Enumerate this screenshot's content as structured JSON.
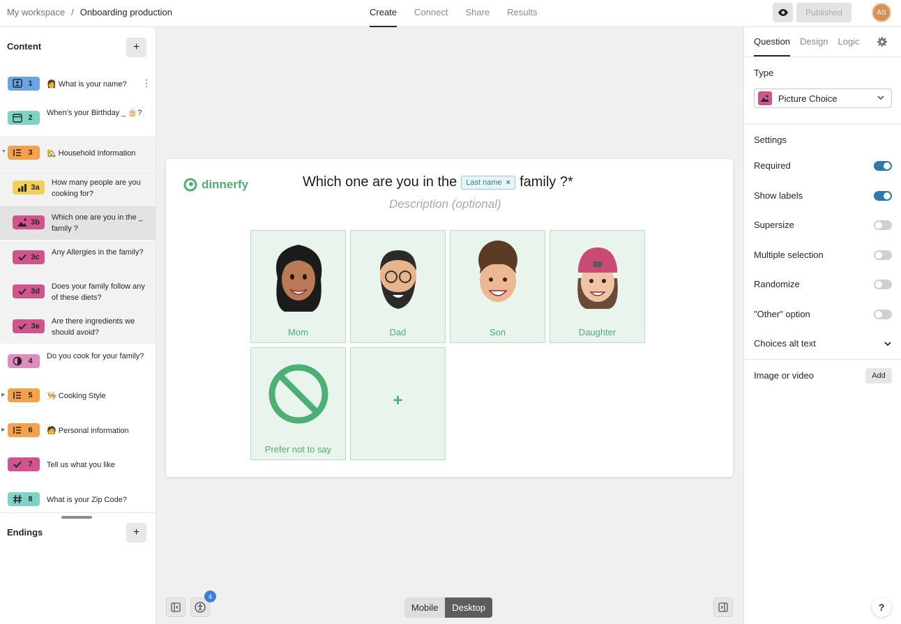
{
  "breadcrumb": {
    "workspace": "My workspace",
    "separator": "/",
    "form": "Onboarding production"
  },
  "nav": {
    "tabs": [
      "Create",
      "Connect",
      "Share",
      "Results"
    ],
    "active": "Create"
  },
  "header": {
    "published_label": "Published",
    "avatar_initials": "AS"
  },
  "sidebar": {
    "content_title": "Content",
    "endings_title": "Endings",
    "items": [
      {
        "num": "1",
        "color": "#6aa3e8",
        "icon": "contact-icon",
        "text": "👩 What is your name?"
      },
      {
        "num": "2",
        "color": "#7fd3c6",
        "icon": "calendar-icon",
        "text": "When's your Birthday _ 🎂?"
      },
      {
        "num": "3",
        "color": "#f4a14a",
        "icon": "list-icon",
        "text": "🏡 Household Information"
      },
      {
        "num": "3a",
        "color": "#f2cf58",
        "icon": "bar-chart-icon",
        "text": "How many people are you cooking for?"
      },
      {
        "num": "3b",
        "color": "#d0558f",
        "icon": "picture-icon",
        "text": "Which one are you in the _ family ?"
      },
      {
        "num": "3c",
        "color": "#d0558f",
        "icon": "check-icon",
        "text": "Any Allergies in the family?"
      },
      {
        "num": "3d",
        "color": "#d0558f",
        "icon": "check-icon",
        "text": "Does your family follow any of these diets?"
      },
      {
        "num": "3e",
        "color": "#d0558f",
        "icon": "check-icon",
        "text": "Are there ingredients we should avoid?"
      },
      {
        "num": "4",
        "color": "#e08cbf",
        "icon": "opinion-icon",
        "text": "Do you cook for your family?"
      },
      {
        "num": "5",
        "color": "#f4a14a",
        "icon": "list-icon",
        "text": "👨‍🍳 Cooking Style"
      },
      {
        "num": "6",
        "color": "#f4a14a",
        "icon": "list-icon",
        "text": "🧑 Personal information"
      },
      {
        "num": "7",
        "color": "#d0558f",
        "icon": "check-icon",
        "text": "Tell us what you like"
      },
      {
        "num": "8",
        "color": "#7fd3c6",
        "icon": "hash-icon",
        "text": "What is your Zip Code?"
      }
    ]
  },
  "question": {
    "brand": "dinnerfy",
    "title_before": "Which one are you in the",
    "tag": "Last name",
    "title_after": "family ?*",
    "description": "Description (optional)",
    "choices": [
      "Mom",
      "Dad",
      "Son",
      "Daughter",
      "Prefer not to say"
    ],
    "add_choice": "+"
  },
  "canvas": {
    "device_mobile": "Mobile",
    "device_desktop": "Desktop",
    "notif_count": "4"
  },
  "panel": {
    "tabs": [
      "Question",
      "Design",
      "Logic"
    ],
    "type_label": "Type",
    "type_value": "Picture Choice",
    "settings_label": "Settings",
    "settings": [
      {
        "label": "Required",
        "on": true
      },
      {
        "label": "Show labels",
        "on": true
      },
      {
        "label": "Supersize",
        "on": false
      },
      {
        "label": "Multiple selection",
        "on": false
      },
      {
        "label": "Randomize",
        "on": false
      },
      {
        "label": "\"Other\" option",
        "on": false
      }
    ],
    "alt_text_label": "Choices alt text",
    "image_label": "Image or video",
    "add_label": "Add",
    "help": "?"
  }
}
